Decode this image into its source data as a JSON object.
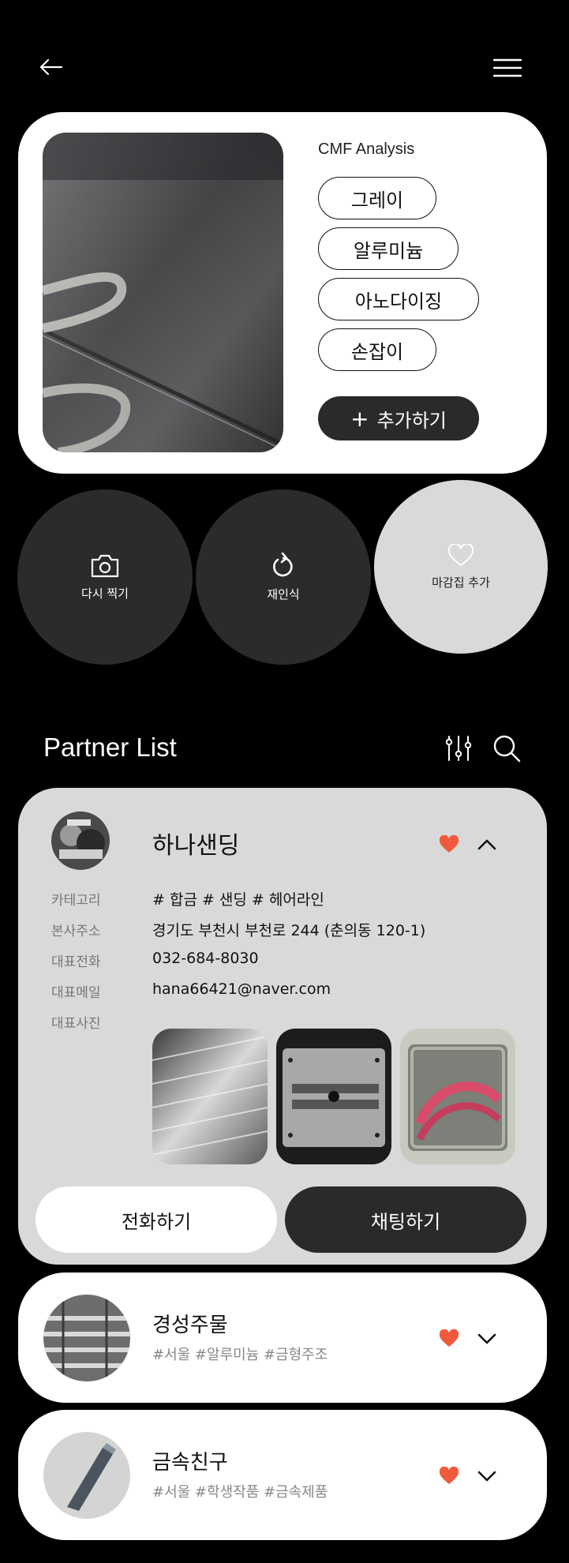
{
  "header": {
    "back_icon": "arrow-left-icon",
    "menu_icon": "hamburger-menu-icon"
  },
  "analysis": {
    "title": "CMF Analysis",
    "tags": [
      "그레이",
      "알루미늄",
      "아노다이징",
      "손잡이"
    ],
    "add_label": "추가하기",
    "add_icon": "plus-icon"
  },
  "actions": {
    "retake": {
      "label": "다시 찍기",
      "icon": "camera-icon"
    },
    "rerecognize": {
      "label": "재인식",
      "icon": "refresh-icon"
    },
    "favorite": {
      "label": "마감집 추가",
      "icon": "heart-outline-icon"
    }
  },
  "partner_list": {
    "title": "Partner List",
    "filter_icon": "sliders-icon",
    "search_icon": "search-icon",
    "partners": [
      {
        "name": "하나샌딩",
        "expanded": true,
        "favorite": true,
        "fields": {
          "labels": [
            "카테고리",
            "본사주소",
            "대표전화",
            "대표메일",
            "대표사진"
          ],
          "category": "# 합금  # 샌딩  # 헤어라인",
          "address": "경기도 부천시 부천로 244 (춘의동 120-1)",
          "phone": "032-684-8030",
          "email": "hana66421@naver.com"
        },
        "call_label": "전화하기",
        "chat_label": "채팅하기"
      },
      {
        "name": "경성주물",
        "tags": "#서울  #알루미늄  #금형주조",
        "favorite": true,
        "expanded": false
      },
      {
        "name": "금속친구",
        "tags": "#서울  #학생작품  #금속제품",
        "favorite": true,
        "expanded": false
      }
    ]
  },
  "colors": {
    "background": "#000000",
    "card_white": "#ffffff",
    "card_gray": "#d9d9d9",
    "dark_button": "#2a2a2a",
    "heart": "#f05a3c"
  }
}
